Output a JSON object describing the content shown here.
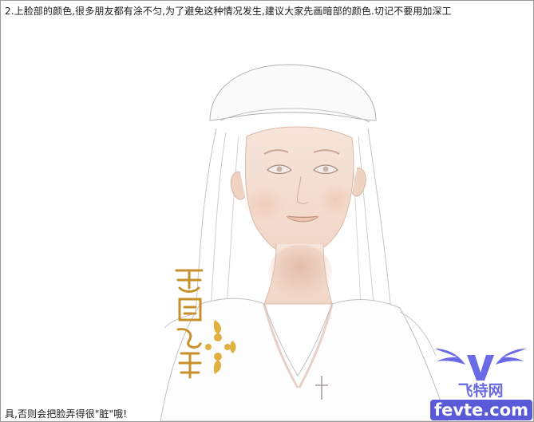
{
  "caption_top": "2.上脸部的颜色,很多朋友都有涂不匀,为了避免这种情况发生,建议大家先画暗部的颜色.切记不要用加深工",
  "caption_bottom": "具,否则会把脸弄得很\"脏\"哦!",
  "watermark": {
    "site_name": "飞特网",
    "site_url": "fevte.com",
    "icon": "winged-v-logo"
  },
  "seal": {
    "icon": "calligraphy-seal",
    "colors": [
      "#c8902a",
      "#e0b040"
    ]
  },
  "colors": {
    "skin_shadow": "#e9c1ae",
    "line": "#9a9a9a",
    "logo": "#6a6ae6"
  }
}
